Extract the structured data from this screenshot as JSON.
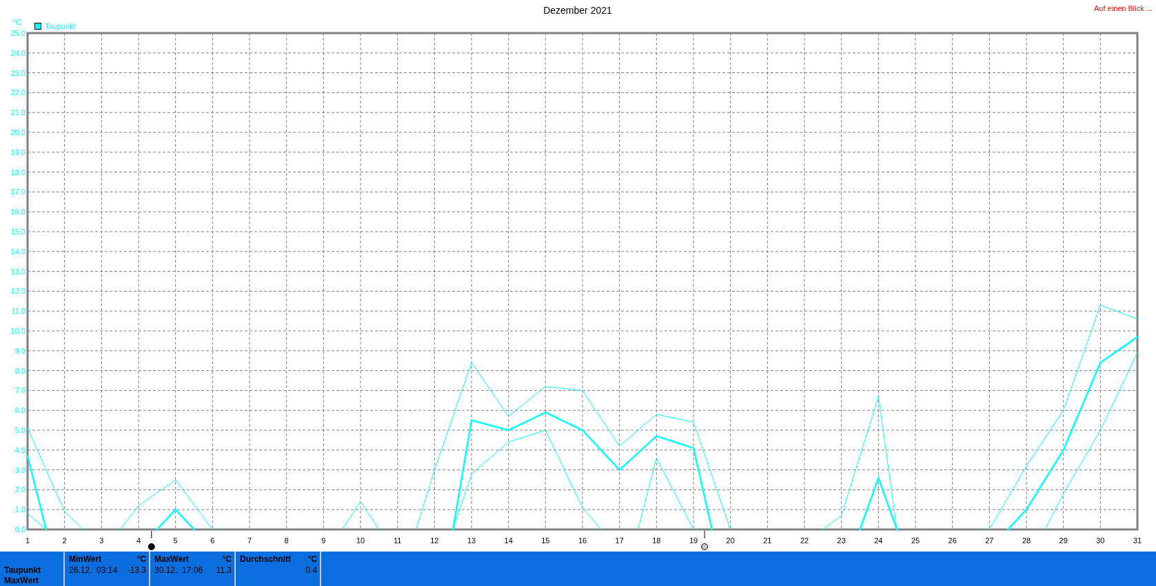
{
  "link": "Auf einen Blick ...",
  "chart_data": {
    "type": "line",
    "title": "Dezember 2021",
    "ylabel": "°C",
    "grid": true,
    "x": [
      1,
      1.5,
      2,
      2.5,
      3,
      3.5,
      4,
      4.5,
      5,
      5.5,
      6,
      6.5,
      7,
      7.5,
      8,
      8.5,
      9,
      9.5,
      10,
      10.5,
      11,
      11.5,
      12,
      12.5,
      13,
      13.5,
      14,
      14.5,
      15,
      15.5,
      16,
      16.5,
      17,
      17.5,
      18,
      18.5,
      19,
      19.5,
      20,
      20.5,
      21,
      21.5,
      22,
      22.5,
      23,
      23.5,
      24,
      24.5,
      25,
      25.5,
      26,
      26.5,
      27,
      27.5,
      28,
      28.5,
      29,
      29.5,
      30,
      30.5,
      31
    ],
    "series": [
      {
        "color": "#00ffff",
        "values": [
          5.1,
          3.0,
          0.9,
          0,
          null,
          0,
          1.2,
          1.85,
          2.5,
          1.25,
          0,
          null,
          null,
          null,
          null,
          null,
          null,
          0,
          1.4,
          0,
          null,
          0,
          3.0,
          5.7,
          8.4,
          7.05,
          5.7,
          6.45,
          7.2,
          7.1,
          7.0,
          5.6,
          4.2,
          5.0,
          5.8,
          5.6,
          5.4,
          2.7,
          0,
          null,
          null,
          null,
          null,
          0,
          0.7,
          3.7,
          6.7,
          0,
          null,
          null,
          null,
          null,
          0,
          1.6,
          3.2,
          4.6,
          6.0,
          8.65,
          11.3,
          10.95,
          10.6
        ]
      },
      {
        "name": "Taupunkt",
        "color": "#00ffff",
        "values": [
          3.7,
          0,
          null,
          null,
          null,
          null,
          null,
          0,
          1.0,
          0,
          null,
          null,
          null,
          null,
          null,
          null,
          null,
          null,
          null,
          null,
          null,
          null,
          null,
          0,
          5.5,
          5.25,
          5.0,
          5.45,
          5.9,
          5.45,
          5.0,
          4.0,
          3.0,
          3.85,
          4.7,
          4.4,
          4.1,
          0,
          null,
          null,
          null,
          null,
          null,
          null,
          null,
          0,
          2.6,
          0,
          null,
          null,
          null,
          null,
          null,
          0,
          1.0,
          2.5,
          4.0,
          6.2,
          8.4,
          9.05,
          9.7
        ]
      },
      {
        "color": "#00ffff",
        "values": [
          0.8,
          0,
          null,
          null,
          null,
          null,
          null,
          null,
          null,
          null,
          null,
          null,
          null,
          null,
          null,
          null,
          null,
          null,
          null,
          null,
          null,
          null,
          null,
          0,
          2.8,
          3.6,
          4.4,
          4.7,
          5.0,
          3.05,
          1.1,
          0,
          null,
          0,
          3.6,
          1.8,
          0,
          null,
          null,
          null,
          null,
          null,
          null,
          null,
          null,
          null,
          null,
          null,
          null,
          null,
          null,
          null,
          null,
          null,
          null,
          0,
          1.8,
          3.4,
          5.0,
          6.95,
          8.9
        ]
      }
    ],
    "xlim": [
      1,
      31
    ],
    "ylim": [
      0,
      25
    ],
    "xticks": [
      1,
      2,
      3,
      4,
      5,
      6,
      7,
      8,
      9,
      10,
      11,
      12,
      13,
      14,
      15,
      16,
      17,
      18,
      19,
      20,
      21,
      22,
      23,
      24,
      25,
      26,
      27,
      28,
      29,
      30,
      31
    ],
    "yticks": [
      {
        "value": 0,
        "label": "0.0"
      },
      {
        "value": 1,
        "label": "1.0"
      },
      {
        "value": 2,
        "label": "2.0"
      },
      {
        "value": 3,
        "label": "3.0"
      },
      {
        "value": 4,
        "label": "4.0"
      },
      {
        "value": 5,
        "label": "5.0"
      },
      {
        "value": 6,
        "label": "6.0"
      },
      {
        "value": 7,
        "label": "7.0"
      },
      {
        "value": 8,
        "label": "8.0"
      },
      {
        "value": 9,
        "label": "9.0"
      },
      {
        "value": 10,
        "label": "10.0"
      },
      {
        "value": 11,
        "label": "11.0"
      },
      {
        "value": 12,
        "label": "12.0"
      },
      {
        "value": 13,
        "label": "13.0"
      },
      {
        "value": 14,
        "label": "14.0"
      },
      {
        "value": 15,
        "label": "15.0"
      },
      {
        "value": 16,
        "label": "16.0"
      },
      {
        "value": 17,
        "label": "17.0"
      },
      {
        "value": 18,
        "label": "18.0"
      },
      {
        "value": 19,
        "label": "19.0"
      },
      {
        "value": 20,
        "label": "20.0"
      },
      {
        "value": 21,
        "label": "21.0"
      },
      {
        "value": 22,
        "label": "22.0"
      },
      {
        "value": 23,
        "label": "23.0"
      },
      {
        "value": 24,
        "label": "24.0"
      },
      {
        "value": 25,
        "label": "25.0"
      }
    ]
  },
  "moon_phases": [
    {
      "kind": "new"
    },
    {
      "kind": "full"
    }
  ],
  "stats": {
    "row_labels": [
      "Taupunkt",
      "MaxWert"
    ],
    "columns": [
      {
        "heading": "MinWert",
        "unit": "°C",
        "date": "26.12.  03:14",
        "value": "-13.3"
      },
      {
        "heading": "MaxWert",
        "unit": "°C",
        "date": "30.12.  17:06",
        "value": "11.3"
      },
      {
        "heading": "Durchschnitt",
        "unit": "°C",
        "value": "0.4"
      }
    ]
  }
}
